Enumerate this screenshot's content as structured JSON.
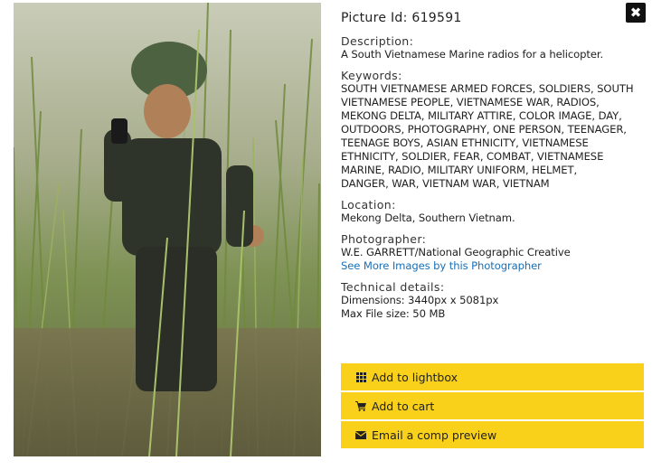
{
  "picture": {
    "id_label": "Picture Id: 619591"
  },
  "description": {
    "label": "Description:",
    "text": "A South Vietnamese Marine radios for a helicopter."
  },
  "keywords": {
    "label": "Keywords:",
    "lines": [
      "SOUTH VIETNAMESE ARMED FORCES, SOLDIERS, SOUTH",
      "VIETNAMESE PEOPLE, VIETNAMESE WAR, RADIOS,",
      "MEKONG DELTA, MILITARY ATTIRE, COLOR IMAGE, DAY,",
      "OUTDOORS, PHOTOGRAPHY, ONE PERSON, TEENAGER,",
      "TEENAGE BOYS, ASIAN ETHNICITY, VIETNAMESE",
      "ETHNICITY, SOLDIER, FEAR, COMBAT, VIETNAMESE",
      "MARINE, RADIO, MILITARY UNIFORM, HELMET,",
      "DANGER, WAR, VIETNAM WAR, VIETNAM"
    ]
  },
  "location": {
    "label": "Location:",
    "text": "Mekong Delta, Southern Vietnam."
  },
  "photographer": {
    "label": "Photographer:",
    "name": "W.E. GARRETT/National Geographic Creative",
    "more_link": "See More Images by this Photographer"
  },
  "technical": {
    "label": "Technical details:",
    "dimensions": "Dimensions: 3440px x 5081px",
    "file_size": "Max File size: 50 MB"
  },
  "actions": {
    "lightbox": "Add to lightbox",
    "cart": "Add to cart",
    "email": "Email a comp preview"
  },
  "icons": {
    "close": "close-icon",
    "lightbox": "grid-icon",
    "cart": "cart-icon",
    "email": "envelope-icon"
  },
  "colors": {
    "button_bg": "#f9d11b",
    "link": "#1a6fb5",
    "close_bg": "#111111"
  }
}
